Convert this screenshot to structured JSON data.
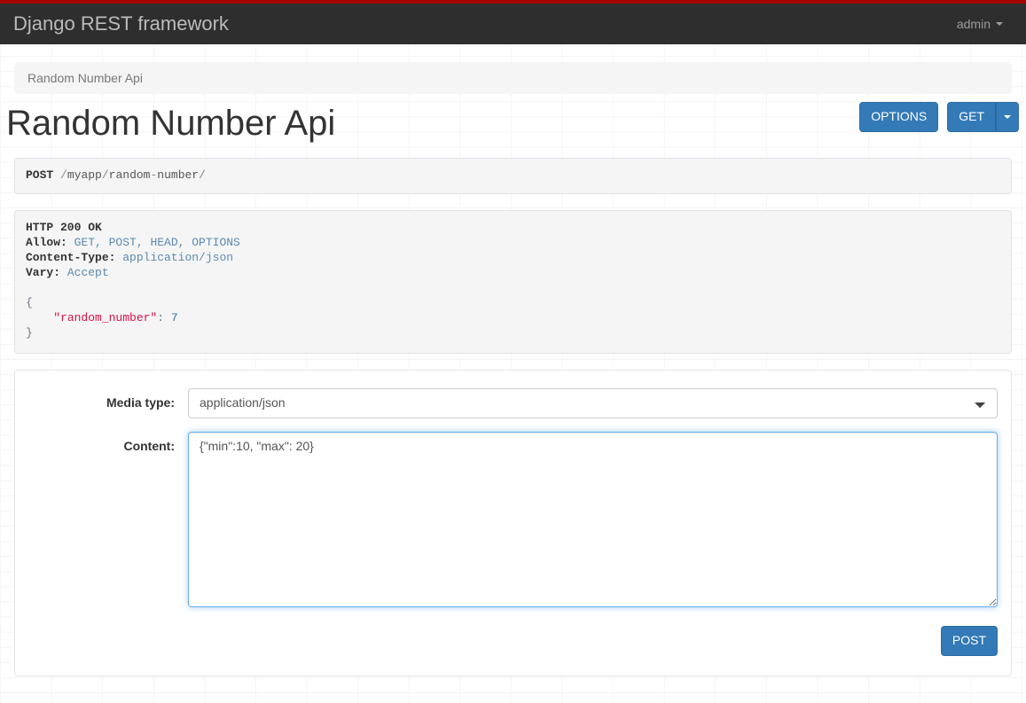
{
  "navbar": {
    "brand": "Django REST framework",
    "user": "admin",
    "caret_icon": "caret-down-icon"
  },
  "breadcrumb": {
    "items": [
      {
        "label": "Random Number Api",
        "active": true
      }
    ]
  },
  "page": {
    "title": "Random Number Api"
  },
  "actions": {
    "options_label": "OPTIONS",
    "get_label": "GET",
    "get_caret_icon": "caret-down-icon"
  },
  "request": {
    "method": "POST",
    "path_parts": [
      "/",
      "myapp",
      "/",
      "random",
      "-",
      "number",
      "/"
    ],
    "full_path": "/myapp/random-number/"
  },
  "response": {
    "status_line": "HTTP 200 OK",
    "headers": [
      {
        "name": "Allow:",
        "value": "GET, POST, HEAD, OPTIONS"
      },
      {
        "name": "Content-Type:",
        "value": "application/json"
      },
      {
        "name": "Vary:",
        "value": "Accept"
      }
    ],
    "body": {
      "open_brace": "{",
      "key": "\"random_number\"",
      "colon": ":",
      "value": "7",
      "close_brace": "}"
    }
  },
  "form": {
    "media_type": {
      "label": "Media type:",
      "selected": "application/json",
      "options": [
        "application/json"
      ]
    },
    "content": {
      "label": "Content:",
      "value": "{\"min\":10, \"max\": 20}",
      "placeholder": ""
    },
    "submit_label": "POST"
  },
  "colors": {
    "top_strip": "#a30000",
    "navbar_bg": "#2e2e2e",
    "primary": "#337ab7",
    "focus_border": "#66afe9",
    "header_value": "#5c8ab0",
    "json_key": "#d14",
    "json_number": "#3a6ea5"
  }
}
